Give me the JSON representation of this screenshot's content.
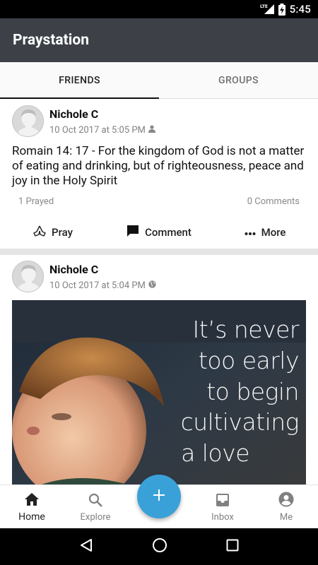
{
  "status_bar": {
    "time": "5:45",
    "network": "LTE"
  },
  "app": {
    "title": "Praystation"
  },
  "tabs": [
    {
      "label": "FRIENDS",
      "active": true
    },
    {
      "label": "GROUPS",
      "active": false
    }
  ],
  "posts": [
    {
      "author": "Nichole C",
      "timestamp": "10 Oct 2017 at 5:05 PM",
      "visibility_icon": "person-icon",
      "text": "Romain 14: 17 - For the kingdom of God is not a matter of eating and drinking, but of righteousness, peace and joy in the Holy Spirit",
      "prayed_count": "1 Prayed",
      "comments_count": "0 Comments",
      "actions": {
        "pray": "Pray",
        "comment": "Comment",
        "more": "More"
      }
    },
    {
      "author": "Nichole C",
      "timestamp": "10 Oct 2017 at 5:04 PM",
      "visibility_icon": "globe-icon",
      "image_quote": [
        "It’s never",
        "too early",
        "to begin",
        "cultivating",
        "a love"
      ]
    }
  ],
  "bottom_nav": {
    "home": "Home",
    "explore": "Explore",
    "inbox": "Inbox",
    "me": "Me"
  },
  "colors": {
    "app_bar": "#3d4147",
    "fab": "#3aa1d8",
    "tab_indicator": "#111111"
  }
}
